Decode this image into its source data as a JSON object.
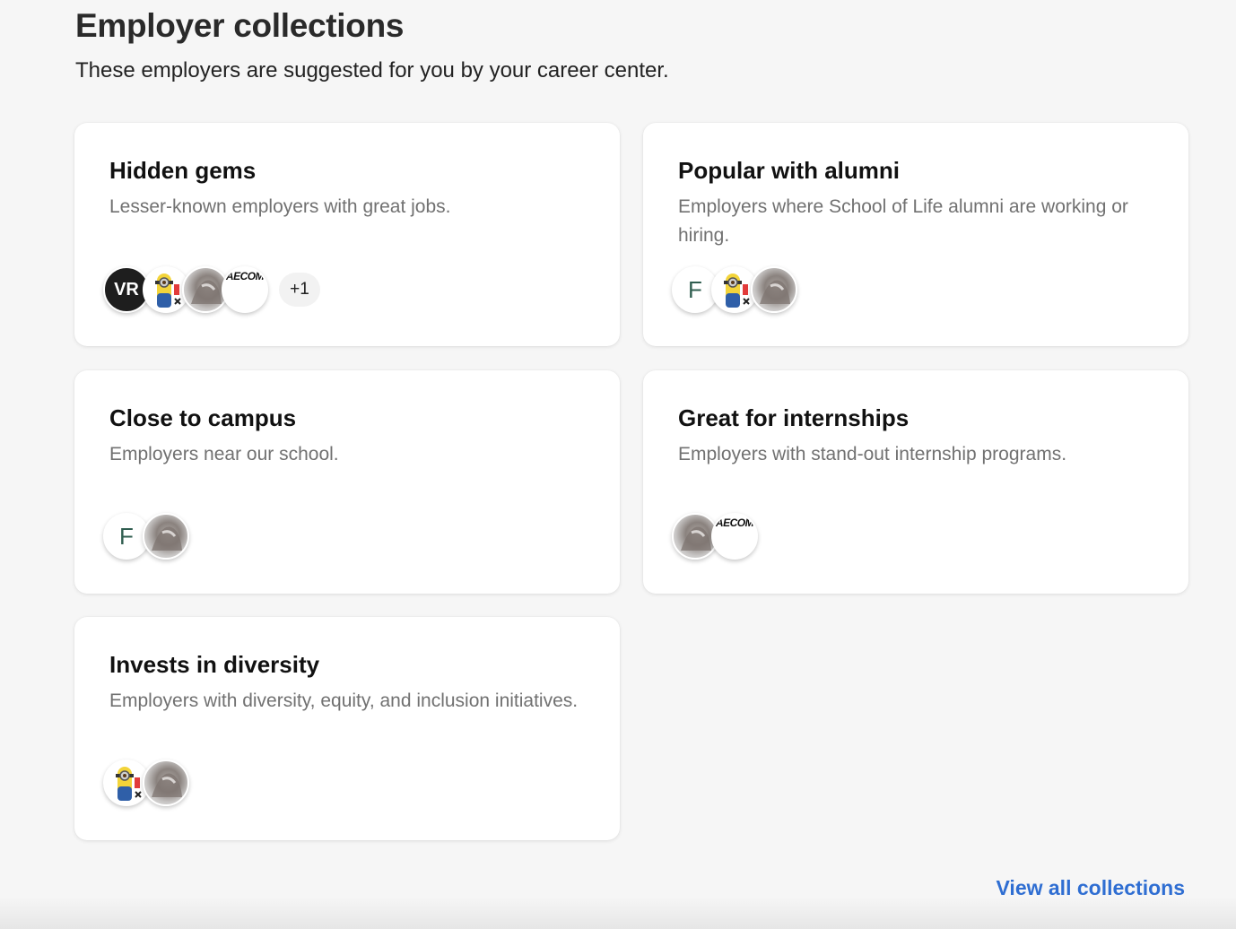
{
  "header": {
    "title": "Employer collections",
    "subtitle": "These employers are suggested for you by your career center."
  },
  "collections": [
    {
      "title": "Hidden gems",
      "description": "Lesser-known employers with great jobs.",
      "avatars": [
        "vr-logo",
        "minion-logo",
        "photo-logo",
        "aecom-logo"
      ],
      "more_label": "+1"
    },
    {
      "title": "Popular with alumni",
      "description": "Employers where School of Life alumni are working or hiring.",
      "avatars": [
        "letter-f",
        "minion-logo",
        "photo-logo"
      ]
    },
    {
      "title": "Close to campus",
      "description": "Employers near our school.",
      "avatars": [
        "letter-f",
        "photo-logo"
      ]
    },
    {
      "title": "Great for internships",
      "description": "Employers with stand-out internship programs.",
      "avatars": [
        "photo-logo",
        "aecom-logo"
      ]
    },
    {
      "title": "Invests in diversity",
      "description": "Employers with diversity, equity, and inclusion initiatives.",
      "avatars": [
        "minion-logo",
        "photo-logo"
      ]
    }
  ],
  "avatar_text": {
    "vr": "VR",
    "f": "F",
    "aecom": "AECOM"
  },
  "footer": {
    "view_all_label": "View all collections"
  },
  "colors": {
    "link": "#2f6ed2",
    "page_background": "#f6f6f6",
    "card_background": "#ffffff"
  }
}
